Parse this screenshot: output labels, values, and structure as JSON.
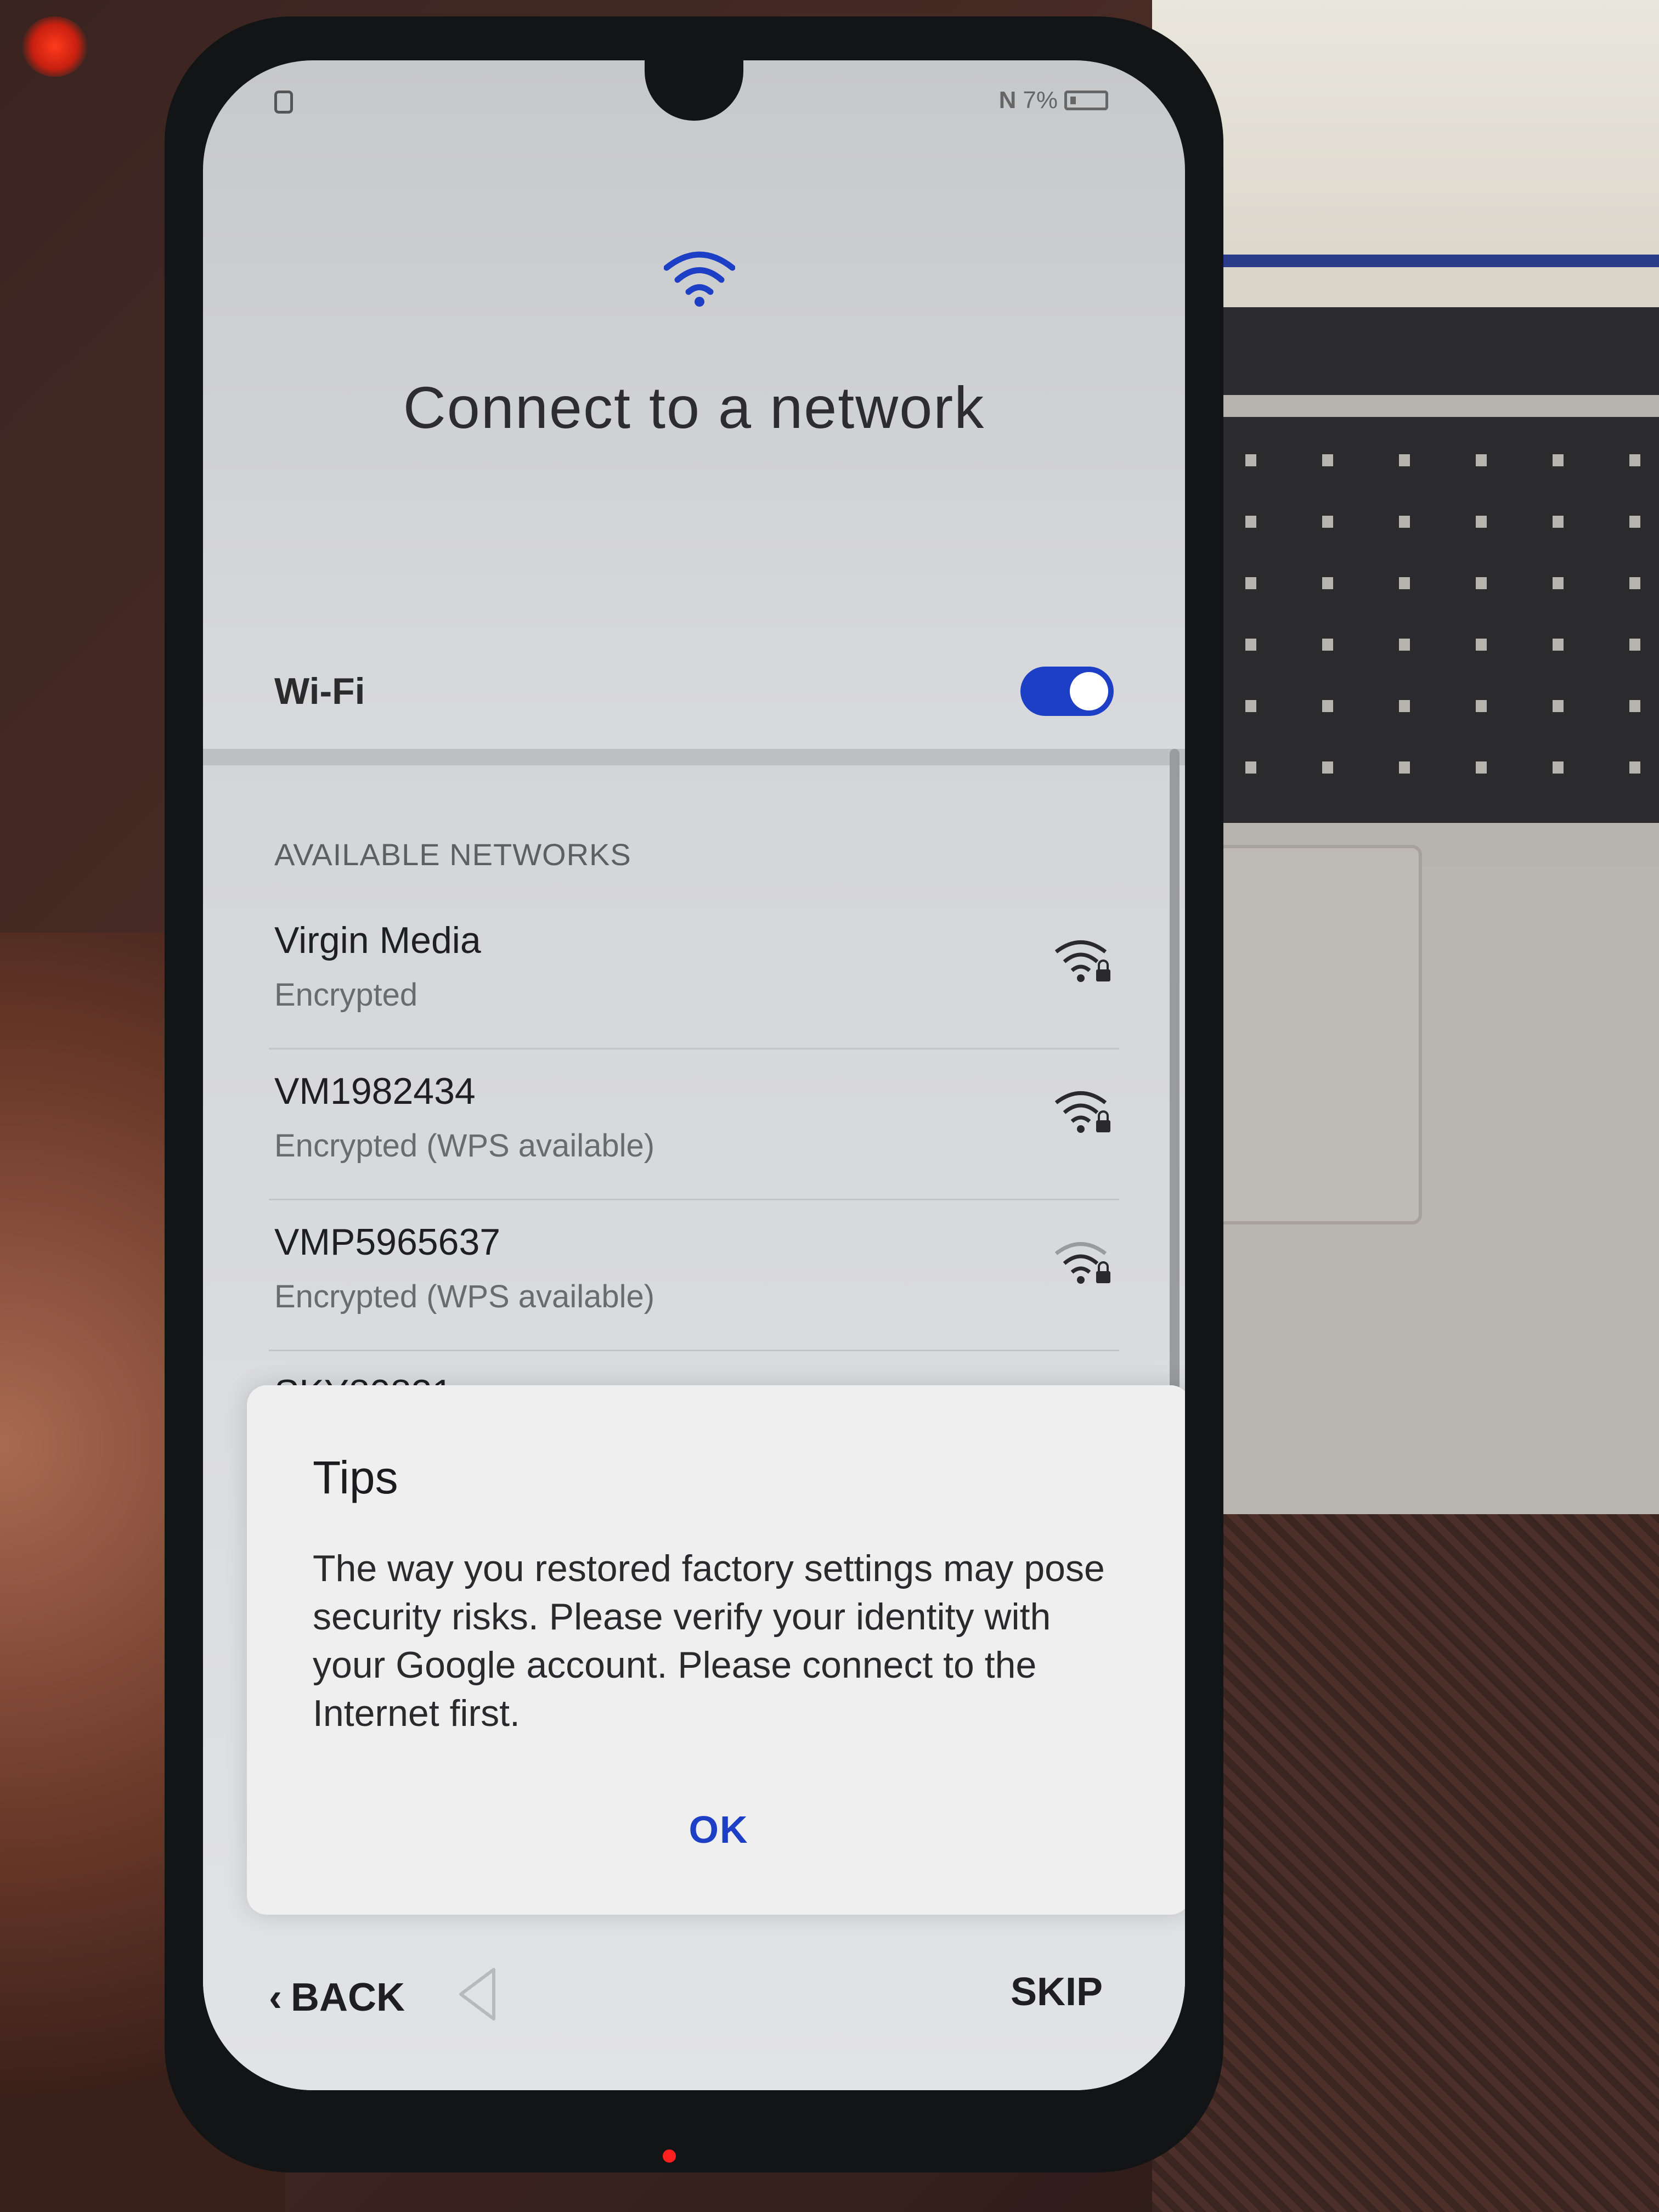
{
  "status_bar": {
    "battery_text": "7%",
    "left_icon": "sim-icon",
    "nfc_icon": "nfc-icon",
    "battery_icon": "battery-icon"
  },
  "header": {
    "icon": "wifi-icon",
    "title": "Connect to a network"
  },
  "wifi_toggle": {
    "label": "Wi-Fi",
    "enabled": true,
    "accent_color": "#1d3fc5"
  },
  "networks": {
    "section_label": "AVAILABLE NETWORKS",
    "items": [
      {
        "name": "Virgin Media",
        "status": "Encrypted",
        "icon": "wifi-lock-icon"
      },
      {
        "name": "VM1982434",
        "status": "Encrypted (WPS available)",
        "icon": "wifi-lock-icon"
      },
      {
        "name": "VMP5965637",
        "status": "Encrypted (WPS available)",
        "icon": "wifi-lock-icon"
      },
      {
        "name": "SKY80821",
        "status": "",
        "icon": "wifi-lock-icon"
      }
    ]
  },
  "dialog": {
    "title": "Tips",
    "body": "The way you restored factory settings may pose security risks. Please verify your identity with your Google account. Please connect to the Internet first.",
    "ok_label": "OK"
  },
  "footer": {
    "back_label": "BACK",
    "skip_label": "SKIP"
  }
}
